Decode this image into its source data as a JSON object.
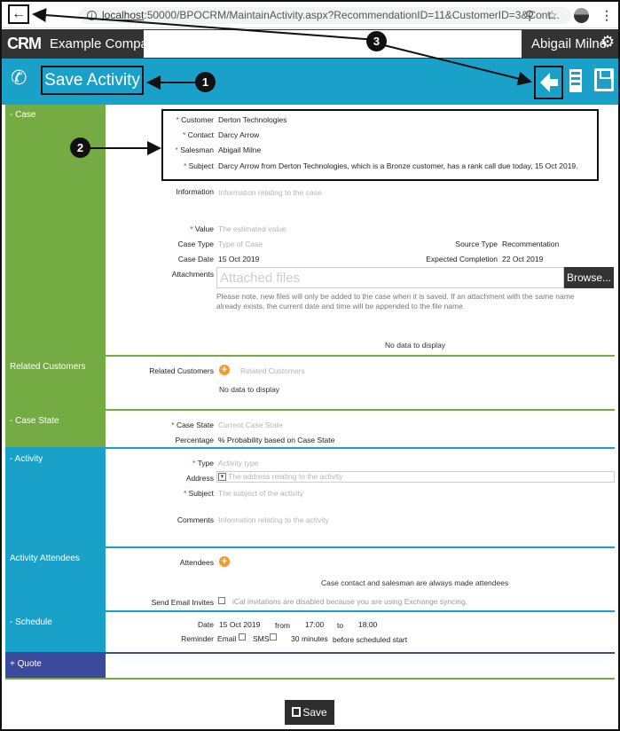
{
  "browser": {
    "url_host": "localhost",
    "url_rest": ":50000/BPOCRM/MaintainActivity.aspx?RecommendationID=11&CustomerID=3&Cont...",
    "icons": [
      "back-arrow-icon",
      "info-icon",
      "zoom-icon",
      "star-icon",
      "profile-icon",
      "menu-dots-icon"
    ]
  },
  "app": {
    "logo": "CRM",
    "company": "Example Company",
    "user": "Abigail Milne"
  },
  "toolbar": {
    "title": "Save Activity",
    "accent": "#1aa1c9"
  },
  "callouts": {
    "c1": "1",
    "c2": "2",
    "c3": "3"
  },
  "sections": {
    "case": {
      "label": "- Case",
      "customer_label": "Customer",
      "customer_value": "Derton Technologies",
      "contact_label": "Contact",
      "contact_value": "Darcy Arrow",
      "salesman_label": "Salesman",
      "salesman_value": "Abigail Milne",
      "subject_label": "Subject",
      "subject_value": "Darcy Arrow from Derton Technologies, which is a Bronze customer, has a rank call due today, 15 Oct 2019.",
      "information_label": "Information",
      "information_placeholder": "Information relating to the case",
      "value_label": "Value",
      "value_placeholder": "The estimated value",
      "case_type_label": "Case Type",
      "case_type_placeholder": "Type of Case",
      "source_type_label": "Source Type",
      "source_type_value": "Recommentation",
      "case_date_label": "Case Date",
      "case_date_value": "15 Oct 2019",
      "expected_label": "Expected Completion",
      "expected_value": "22 Oct 2019",
      "attachments_label": "Attachments",
      "attachments_placeholder": "Attached files",
      "browse_label": "Browse...",
      "attachments_note": "Please note, new files will only be added to the case when it is saved. If an attachment with the same name already exists, the current date and time will be appended to the file name.",
      "no_data": "No data to display",
      "color": "#74ab43"
    },
    "related": {
      "label": "Related Customers",
      "field_label": "Related Customers",
      "placeholder": "Related Customers",
      "no_data": "No data to display",
      "color": "#74ab43"
    },
    "case_state": {
      "label": "- Case State",
      "state_label": "Case State",
      "state_placeholder": "Current Case State",
      "percentage_label": "Percentage",
      "percentage_value": "% Probability based on Case State",
      "color": "#74ab43"
    },
    "activity": {
      "label": "- Activity",
      "type_label": "Type",
      "type_placeholder": "Activity type",
      "address_label": "Address",
      "address_placeholder": "The address relating to the activity",
      "subject_label": "Subject",
      "subject_placeholder": "The subject of the activity",
      "comments_label": "Comments",
      "comments_placeholder": "Information relating to the activity",
      "color": "#1aa1c9"
    },
    "attendees": {
      "label": "Activity Attendees",
      "attendees_label": "Attendees",
      "note": "Case contact and salesman are always made attendees",
      "invites_label": "Send Email Invites",
      "invites_note": "iCal invitations are disabled because you are using Exchange syncing.",
      "color": "#1aa1c9"
    },
    "schedule": {
      "label": "- Schedule",
      "date_label": "Date",
      "date_value": "15 Oct 2019",
      "from_label": "from",
      "from_value": "17:00",
      "to_label": "to",
      "to_value": "18:00",
      "reminder_label": "Reminder",
      "email_label": "Email",
      "sms_label": "SMS",
      "minutes_value": "30",
      "minutes_label": "minutes",
      "before_label": "before scheduled start",
      "color": "#1aa1c9"
    },
    "quote": {
      "label": "+ Quote",
      "color": "#3b4a9d"
    }
  },
  "footer": {
    "save_label": "Save"
  }
}
